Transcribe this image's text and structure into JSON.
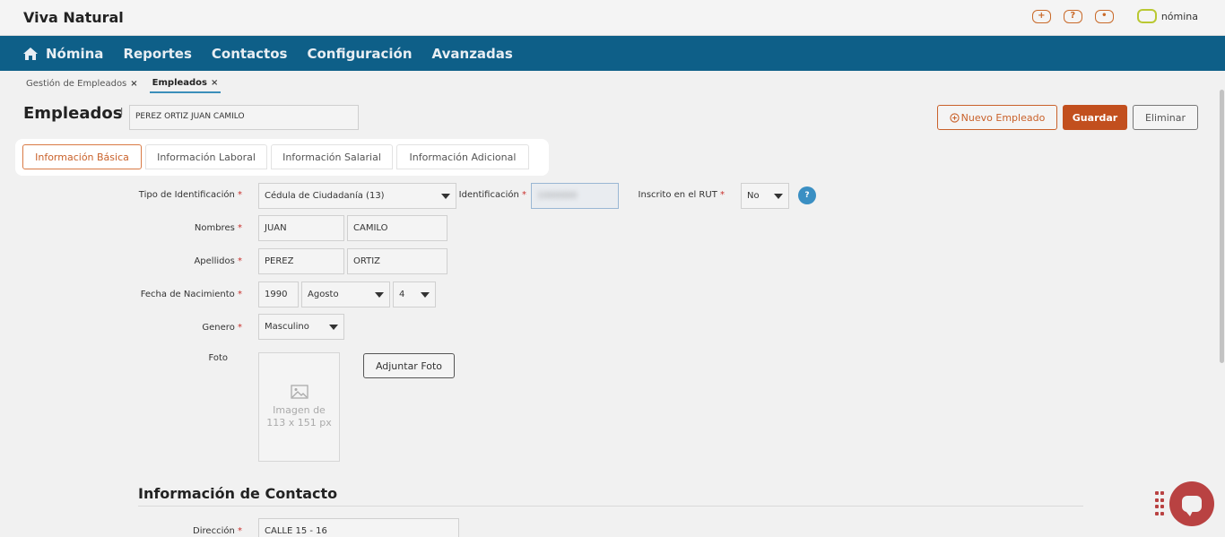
{
  "app": {
    "title": "Viva Natural",
    "logo_text": "nómina"
  },
  "top_icons": {
    "add": "+",
    "help": "?",
    "user": "•"
  },
  "nav": {
    "items": [
      {
        "label": "Nómina",
        "icon": "home-icon"
      },
      {
        "label": "Reportes"
      },
      {
        "label": "Contactos"
      },
      {
        "label": "Configuración"
      },
      {
        "label": "Avanzadas"
      }
    ]
  },
  "breadcrumbs": [
    {
      "label": "Gestión de Empleados",
      "active": false
    },
    {
      "label": "Empleados",
      "active": true
    }
  ],
  "page": {
    "title": "Empleados",
    "separator": "I",
    "employee_name": "PEREZ ORTIZ JUAN CAMILO"
  },
  "actions": {
    "new_employee": "Nuevo Empleado",
    "save": "Guardar",
    "delete": "Eliminar"
  },
  "tabs": [
    {
      "label": "Información Básica",
      "active": true
    },
    {
      "label": "Información Laboral",
      "active": false
    },
    {
      "label": "Información Salarial",
      "active": false
    },
    {
      "label": "Información Adicional",
      "active": false
    }
  ],
  "form": {
    "id_type": {
      "label": "Tipo de Identificación",
      "value": "Cédula de Ciudadanía (13)"
    },
    "id_number": {
      "label": "Identificación",
      "value": "1000000"
    },
    "rut": {
      "label": "Inscrito en el RUT",
      "value": "No",
      "help": "?"
    },
    "names": {
      "label": "Nombres",
      "first": "JUAN",
      "second": "CAMILO"
    },
    "surnames": {
      "label": "Apellidos",
      "first": "PEREZ",
      "second": "ORTIZ"
    },
    "birth": {
      "label": "Fecha de Nacimiento",
      "year": "1990",
      "month": "Agosto",
      "day": "4"
    },
    "gender": {
      "label": "Genero",
      "value": "Masculino"
    },
    "photo": {
      "label": "Foto",
      "placeholder_line1": "Imagen de",
      "placeholder_line2": "113 x 151 px",
      "attach_button": "Adjuntar Foto"
    },
    "required_mark": "*"
  },
  "contact": {
    "title": "Información de Contacto",
    "address": {
      "label": "Dirección",
      "value": "CALLE 15 - 16"
    }
  },
  "colors": {
    "nav_bg": "#0e5f88",
    "accent": "#c24f1e",
    "help": "#3a8fc3",
    "chat": "#b94242"
  }
}
